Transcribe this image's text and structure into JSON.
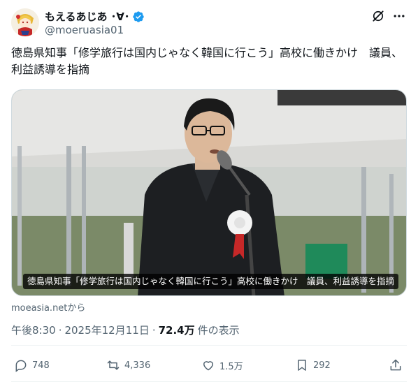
{
  "author": {
    "display_name": "もえるあじあ ･∀･",
    "handle": "@moeruasia01",
    "verified": true
  },
  "tweet": {
    "text": "徳島県知事「修学旅行は国内じゃなく韓国に行こう」高校に働きかけ　議員、利益誘導を指摘"
  },
  "media": {
    "caption": "徳島県知事「修学旅行は国内じゃなく韓国に行こう」高校に働きかけ　議員、利益誘導を指摘",
    "source": "moeasia.netから"
  },
  "meta": {
    "time": "午後8:30",
    "date": "2025年12月11日",
    "views": "72.4万",
    "views_label": "件の表示",
    "separator": "·"
  },
  "actions": {
    "reply_count": "748",
    "retweet_count": "4,336",
    "like_count": "1.5万",
    "bookmark_count": "292"
  },
  "icons": {
    "grok": "grok-icon",
    "more": "more-icon",
    "reply": "reply-icon",
    "retweet": "retweet-icon",
    "like": "like-icon",
    "bookmark": "bookmark-icon",
    "share": "share-icon",
    "verified": "verified-badge-icon"
  },
  "colors": {
    "text": "#0f1419",
    "secondary": "#536471",
    "verified": "#1d9bf0",
    "divider": "#eff3f4"
  }
}
